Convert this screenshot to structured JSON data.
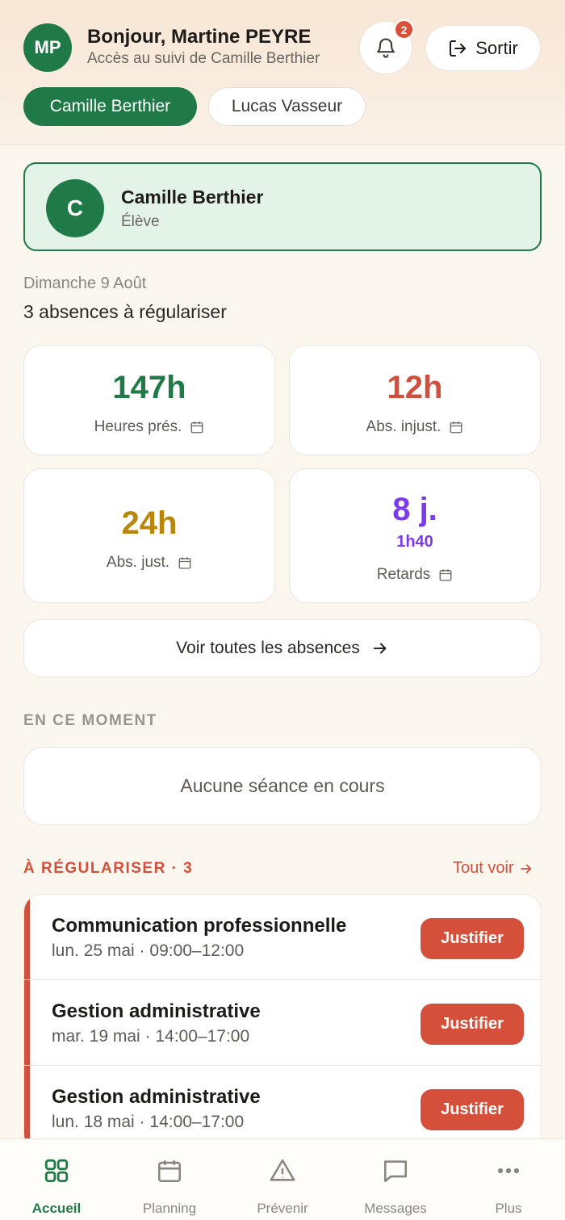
{
  "header": {
    "initials": "MP",
    "greeting": "Bonjour, Martine PEYRE",
    "subtitle": "Accès au suivi de Camille Berthier",
    "notification_count": "2",
    "logout_label": "Sortir"
  },
  "children": [
    {
      "label": "Camille Berthier",
      "active": true
    },
    {
      "label": "Lucas Vasseur",
      "active": false
    }
  ],
  "student": {
    "initial": "C",
    "name": "Camille Berthier",
    "role": "Élève"
  },
  "summary": {
    "date": "Dimanche 9 Août",
    "absences_text": "3 absences à régulariser"
  },
  "stats": [
    {
      "value": "147h",
      "label": "Heures prés.",
      "color": "#1f7a47"
    },
    {
      "value": "12h",
      "label": "Abs. injust.",
      "color": "#d0503b"
    },
    {
      "value": "24h",
      "label": "Abs. just.",
      "color": "#b8860b"
    },
    {
      "value": "8 j.",
      "sub": "1h40",
      "label": "Retards",
      "color": "#7c3aed"
    }
  ],
  "all_absences_label": "Voir toutes les absences",
  "now": {
    "title": "EN CE MOMENT",
    "empty_text": "Aucune séance en cours"
  },
  "to_regularize": {
    "title": "À RÉGULARISER · 3",
    "see_all": "Tout voir",
    "items": [
      {
        "title": "Communication professionnelle",
        "time": "lun. 25 mai · 09:00–12:00",
        "action": "Justifier"
      },
      {
        "title": "Gestion administrative",
        "time": "mar. 19 mai · 14:00–17:00",
        "action": "Justifier"
      },
      {
        "title": "Gestion administrative",
        "time": "lun. 18 mai · 14:00–17:00",
        "action": "Justifier"
      }
    ]
  },
  "nav": [
    {
      "label": "Accueil",
      "icon": "grid-icon",
      "active": true
    },
    {
      "label": "Planning",
      "icon": "calendar-icon",
      "active": false
    },
    {
      "label": "Prévenir",
      "icon": "warning-icon",
      "active": false
    },
    {
      "label": "Messages",
      "icon": "message-icon",
      "active": false
    },
    {
      "label": "Plus",
      "icon": "more-icon",
      "active": false
    }
  ],
  "colors": {
    "brand_green": "#1f7a47",
    "alert_red": "#d0503b",
    "amber": "#b8860b",
    "purple": "#7c3aed"
  }
}
